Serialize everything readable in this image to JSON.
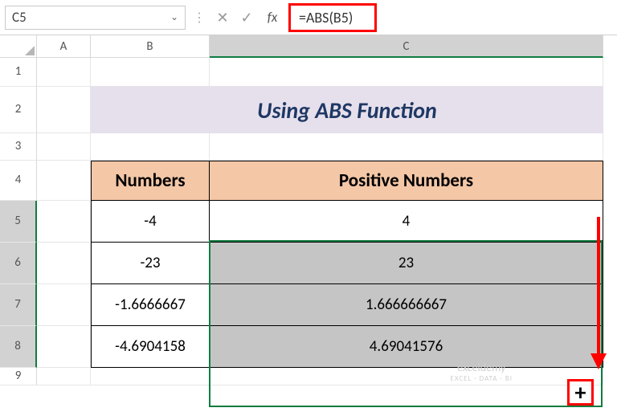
{
  "name_box": "C5",
  "formula": "=ABS(B5)",
  "icons": {
    "cancel": "✕",
    "enter": "✓",
    "dropdown": "⌄",
    "fx": "fx"
  },
  "columns": [
    "A",
    "B",
    "C"
  ],
  "rows": [
    "1",
    "2",
    "3",
    "4",
    "5",
    "6",
    "7",
    "8",
    "9"
  ],
  "title": "Using ABS Function",
  "headers": {
    "b": "Numbers",
    "c": "Positive Numbers"
  },
  "data": {
    "b5": "-4",
    "c5": "4",
    "b6": "-23",
    "c6": "23",
    "b7": "-1.6666667",
    "c7": "1.666666667",
    "b8": "-4.6904158",
    "c8": "4.69041576"
  },
  "fill_handle_glyph": "+",
  "watermark": {
    "main": "exceldemy",
    "sub": "EXCEL · DATA · BI"
  },
  "chart_data": {
    "type": "table",
    "title": "Using ABS Function",
    "columns": [
      "Numbers",
      "Positive Numbers"
    ],
    "rows": [
      [
        -4,
        4
      ],
      [
        -23,
        23
      ],
      [
        -1.6666667,
        1.666666667
      ],
      [
        -4.6904158,
        4.69041576
      ]
    ]
  }
}
